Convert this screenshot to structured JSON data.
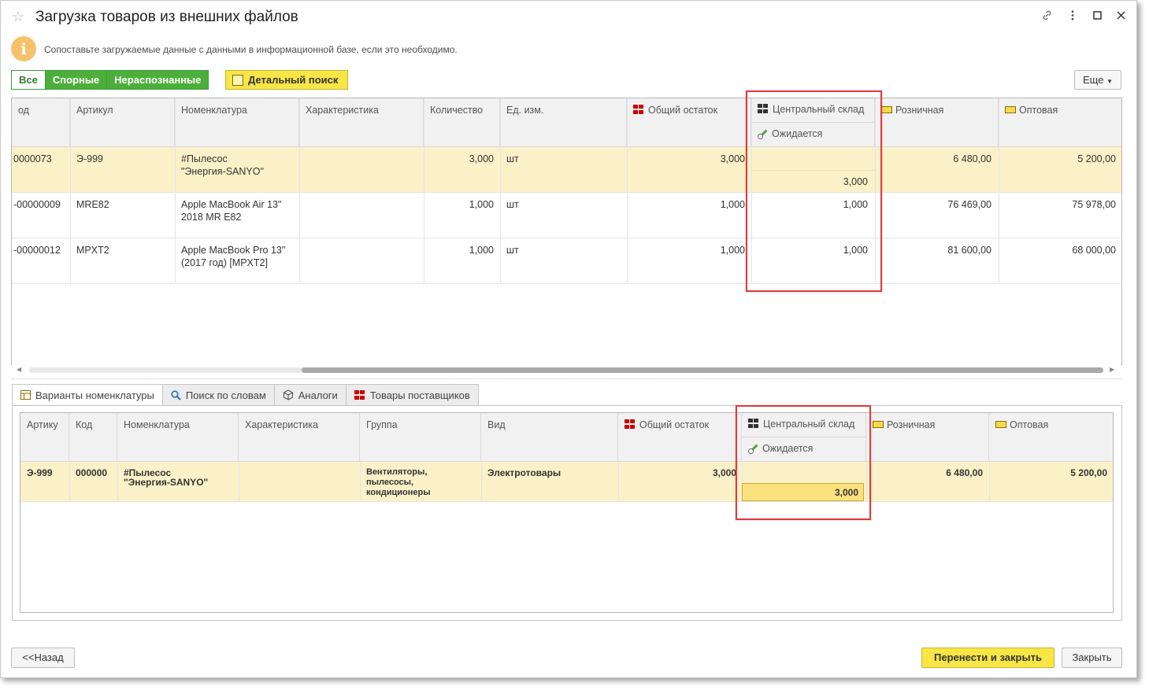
{
  "window": {
    "title": "Загрузка товаров из внешних файлов",
    "icons": [
      "star-icon",
      "link-icon",
      "more-vertical-icon",
      "maximize-icon",
      "close-icon"
    ]
  },
  "info": {
    "icon": "i",
    "text": "Сопоставьте загружаемые данные с данными в информационной базе, если это необходимо."
  },
  "filters": {
    "all": "Все",
    "disputed": "Спорные",
    "unrecognized": "Нераспознанные"
  },
  "toolbar": {
    "detailed_search": "Детальный поиск",
    "more": "Еще"
  },
  "upper_table": {
    "headers": {
      "code": "од",
      "article": "Артикул",
      "nomenclature": "Номенклатура",
      "characteristic": "Характеристика",
      "quantity": "Количество",
      "unit": "Ед. изм.",
      "total_stock": "Общий остаток",
      "central_warehouse": "Центральный склад",
      "expected": "Ожидается",
      "retail": "Розничная",
      "wholesale": "Оптовая"
    },
    "rows": [
      {
        "code": "0000073",
        "article": "Э-999",
        "name1": "#Пылесос",
        "name2": "\"Энергия-SANYO\"",
        "quantity": "3,000",
        "unit": "шт",
        "total": "3,000",
        "central": "",
        "expected": "3,000",
        "retail": "6 480,00",
        "wholesale": "5 200,00"
      },
      {
        "code": "-00000009",
        "article": "MRE82",
        "name1": "Apple MacBook Air 13\"",
        "name2": "2018 MR E82",
        "quantity": "1,000",
        "unit": "шт",
        "total": "1,000",
        "central": "1,000",
        "expected": "",
        "retail": "76 469,00",
        "wholesale": "75 978,00"
      },
      {
        "code": "-00000012",
        "article": "MPXT2",
        "name1": "Apple MacBook Pro 13\"",
        "name2": "(2017 год) [MPXT2]",
        "quantity": "1,000",
        "unit": "шт",
        "total": "1,000",
        "central": "1,000",
        "expected": "",
        "retail": "81 600,00",
        "wholesale": "68 000,00"
      }
    ]
  },
  "tabs": {
    "variants": "Варианты номенклатуры",
    "search_words": "Поиск по словам",
    "analogs": "Аналоги",
    "supplier_goods": "Товары поставщиков"
  },
  "lower_table": {
    "headers": {
      "article": "Артику",
      "code": "Код",
      "nomenclature": "Номенклатура",
      "characteristic": "Характеристика",
      "group": "Группа",
      "kind": "Вид",
      "total_stock": "Общий остаток",
      "central_warehouse": "Центральный склад",
      "expected": "Ожидается",
      "retail": "Розничная",
      "wholesale": "Оптовая"
    },
    "row": {
      "article": "Э-999",
      "code": "000000",
      "name1": "#Пылесос",
      "name2": "\"Энергия-SANYO\"",
      "group1": "Вентиляторы,",
      "group2": "пылесосы,",
      "group3": "кондиционеры",
      "kind": "Электротовары",
      "total": "3,000",
      "expected": "3,000",
      "retail": "6 480,00",
      "wholesale": "5 200,00"
    }
  },
  "footer": {
    "back": "<<Назад",
    "transfer_close": "Перенести и закрыть",
    "close": "Закрыть"
  },
  "colors": {
    "accent_green": "#4caf3a",
    "accent_yellow": "#f7e646",
    "selected_row": "#fbf1c8",
    "highlight_box": "#e3393f"
  }
}
